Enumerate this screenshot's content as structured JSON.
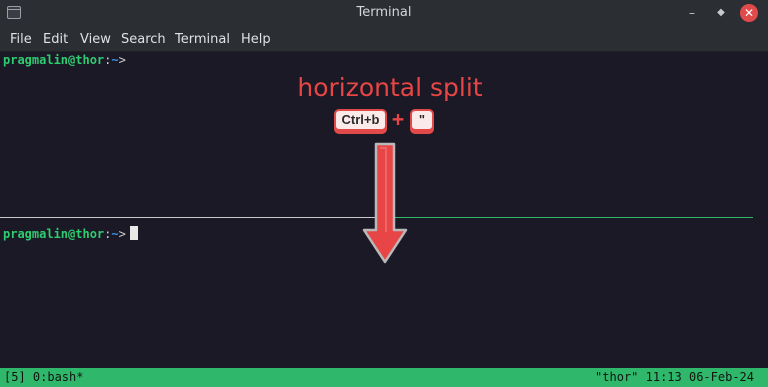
{
  "window": {
    "title": "Terminal",
    "controls": {
      "minimize": "–",
      "maximize": "◆",
      "close": "✕"
    }
  },
  "menu": {
    "items": [
      "File",
      "Edit",
      "View",
      "Search",
      "Terminal",
      "Help"
    ]
  },
  "panes": {
    "top": {
      "user_host": "pragmalin@thor",
      "sep": ":",
      "path": "~",
      "symbol": ">"
    },
    "bottom": {
      "user_host": "pragmalin@thor",
      "sep": ":",
      "path": "~",
      "symbol": ">"
    }
  },
  "annotation": {
    "title": "horizontal split",
    "key1": "Ctrl+b",
    "plus": "+",
    "key2": "\""
  },
  "statusbar": {
    "left": "[5] 0:bash*",
    "right": "\"thor\" 11:13 06-Feb-24"
  },
  "colors": {
    "accent_green": "#2fb76b",
    "annotation_red": "#e84646",
    "prompt_user": "#2fcc70",
    "prompt_path": "#3a8fe8"
  }
}
